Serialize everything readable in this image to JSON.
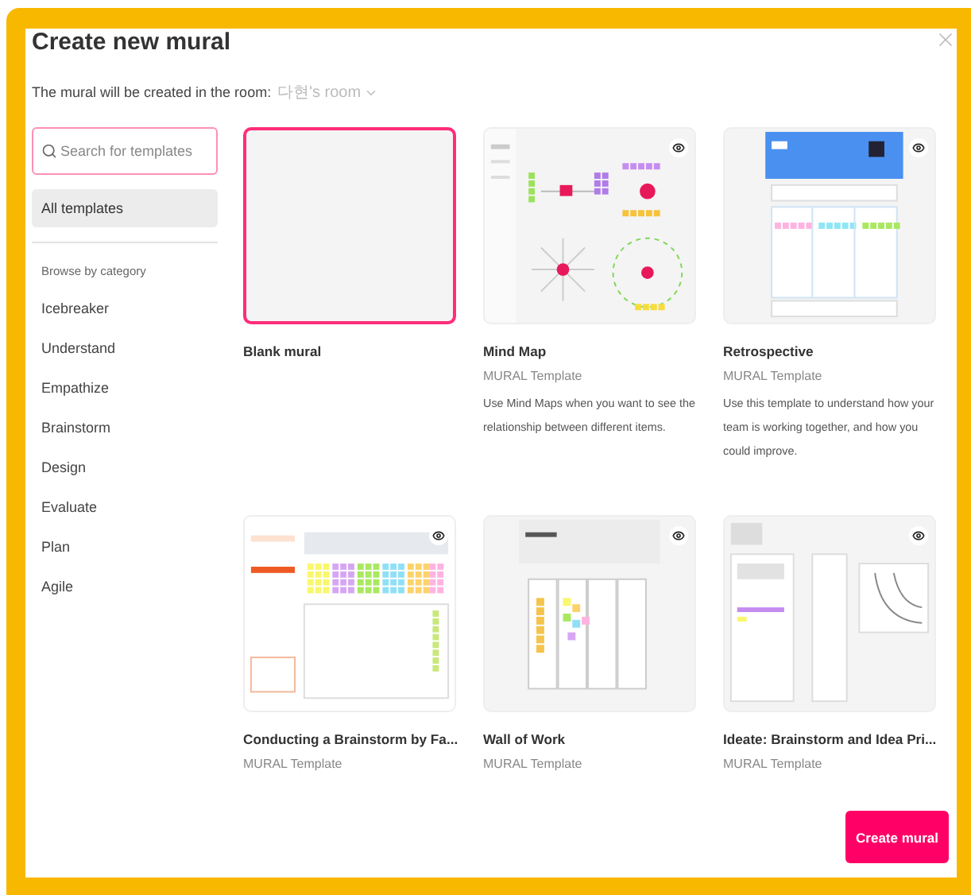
{
  "dialog": {
    "title": "Create new mural",
    "room_prompt": "The mural will be created in the room:",
    "room": "다현's room"
  },
  "search": {
    "placeholder": "Search for templates"
  },
  "sidebar": {
    "all_templates": {
      "label": "All templates",
      "selected": true
    },
    "section": "Browse by category",
    "categories": [
      {
        "label": "Icebreaker",
        "selected": false
      },
      {
        "label": "Understand",
        "selected": false
      },
      {
        "label": "Empathize",
        "selected": false
      },
      {
        "label": "Brainstorm",
        "selected": false
      },
      {
        "label": "Design",
        "selected": false
      },
      {
        "label": "Evaluate",
        "selected": false
      },
      {
        "label": "Plan",
        "selected": false
      },
      {
        "label": "Agile",
        "selected": false
      }
    ]
  },
  "templates": [
    {
      "kind": "blank",
      "title": "Blank mural",
      "selected": true
    },
    {
      "kind": "mind-map",
      "title": "Mind Map",
      "subtitle": "MURAL Template",
      "description": "Use Mind Maps when you want to see the relationship between different items.",
      "selected": false
    },
    {
      "kind": "retrospective",
      "title": "Retrospective",
      "subtitle": "MURAL Template",
      "description": "Use this template to understand how your team is working together, and how you could improve.",
      "selected": false
    },
    {
      "kind": "brainstorm",
      "title": "Conducting a Brainstorm by Fa...",
      "subtitle": "MURAL Template",
      "selected": false
    },
    {
      "kind": "wall",
      "title": "Wall of Work",
      "subtitle": "MURAL Template",
      "selected": false
    },
    {
      "kind": "ideate",
      "title": "Ideate: Brainstorm and Idea Pri...",
      "subtitle": "MURAL Template",
      "selected": false
    }
  ],
  "create_button": "Create mural"
}
